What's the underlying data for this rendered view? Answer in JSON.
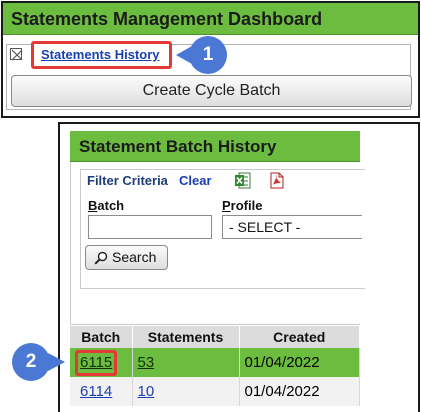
{
  "top": {
    "title": "Statements Management Dashboard",
    "history_link": "Statements History",
    "create_cycle_batch": "Create Cycle Batch"
  },
  "markers": [
    "1",
    "2"
  ],
  "batch_history": {
    "title": "Statement Batch History",
    "filter": {
      "legend": "Filter Criteria",
      "clear": "Clear",
      "export_icons": [
        "excel-icon",
        "pdf-icon"
      ],
      "batch_label_first": "B",
      "batch_label_rest": "atch",
      "batch_value": "",
      "profile_label_first": "P",
      "profile_label_rest": "rofile",
      "profile_selected": "- SELECT -",
      "search_label": "Search"
    },
    "table": {
      "headers": [
        "Batch",
        "Statements",
        "Created"
      ],
      "rows": [
        {
          "batch": "6115",
          "statements": "53",
          "created": "01/04/2022",
          "selected": true
        },
        {
          "batch": "6114",
          "statements": "10",
          "created": "01/04/2022",
          "selected": false
        }
      ]
    }
  },
  "colors": {
    "header_green": "#6cbd3f",
    "link_blue": "#1a3fb3",
    "highlight_red": "#e53935",
    "marker_blue": "#4a78d4"
  }
}
